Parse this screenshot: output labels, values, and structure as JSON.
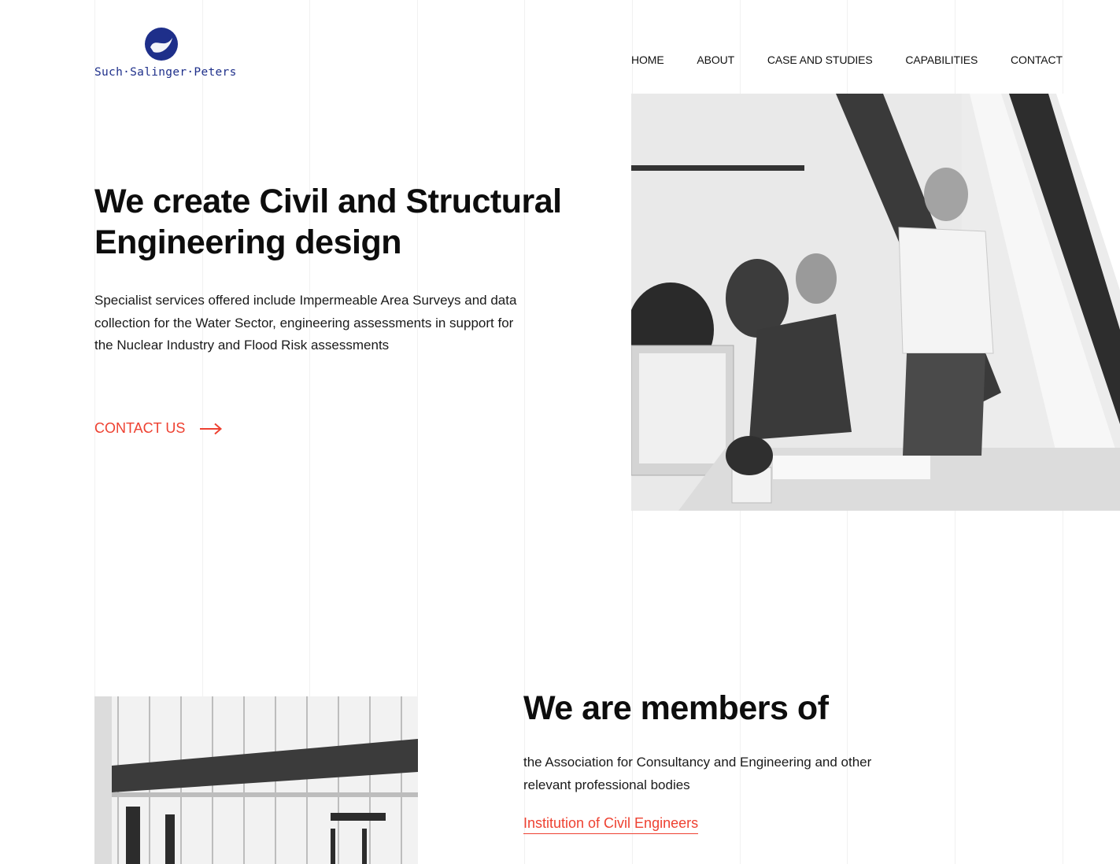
{
  "logo": {
    "text": "Such·Salinger·Peters",
    "brand_color": "#1e2f8a"
  },
  "nav": {
    "items": [
      "HOME",
      "ABOUT",
      "CASE AND STUDIES",
      "CAPABILITIES",
      "CONTACT"
    ]
  },
  "hero": {
    "title": "We create Civil and Structural Engineering design",
    "description": "Specialist services offered include Impermeable Area Surveys and data collection for the Water Sector, engineering assessments in support for the Nuclear Industry and Flood Risk assessments",
    "cta_label": "CONTACT US",
    "accent_color": "#ee4131"
  },
  "members": {
    "title": "We are members of",
    "description": "the Association for Consultancy and Engineering and other relevant professional bodies",
    "link_label": "Institution of Civil Engineers"
  }
}
